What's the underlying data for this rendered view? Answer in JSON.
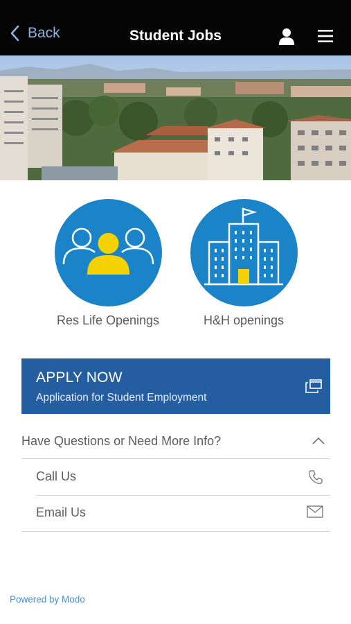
{
  "navbar": {
    "back_label": "Back",
    "title": "Student Jobs",
    "icons": [
      "chevron-left-icon",
      "user-icon",
      "hamburger-menu-icon"
    ]
  },
  "hero": {
    "image": "campus-aerial-photo"
  },
  "tiles": [
    {
      "label": "Res Life Openings",
      "icon": "group-people-icon"
    },
    {
      "label": "H&H openings",
      "icon": "building-icon"
    }
  ],
  "apply": {
    "title": "APPLY NOW",
    "subtitle": "Application for Student Employment",
    "icon": "external-window-icon"
  },
  "questions": {
    "label": "Have Questions or Need More Info?",
    "icon": "chevron-up-icon",
    "items": [
      {
        "label": "Call Us",
        "icon": "phone-icon"
      },
      {
        "label": "Email Us",
        "icon": "envelope-icon"
      }
    ]
  },
  "footer": {
    "powered_by": "Powered by Modo"
  },
  "colors": {
    "navbar_bg": "#050505",
    "accent_blue": "#245ea0",
    "tile_blue": "#1b84c8",
    "highlight_yellow": "#f6d200",
    "link_blue": "#4c8fd0"
  }
}
